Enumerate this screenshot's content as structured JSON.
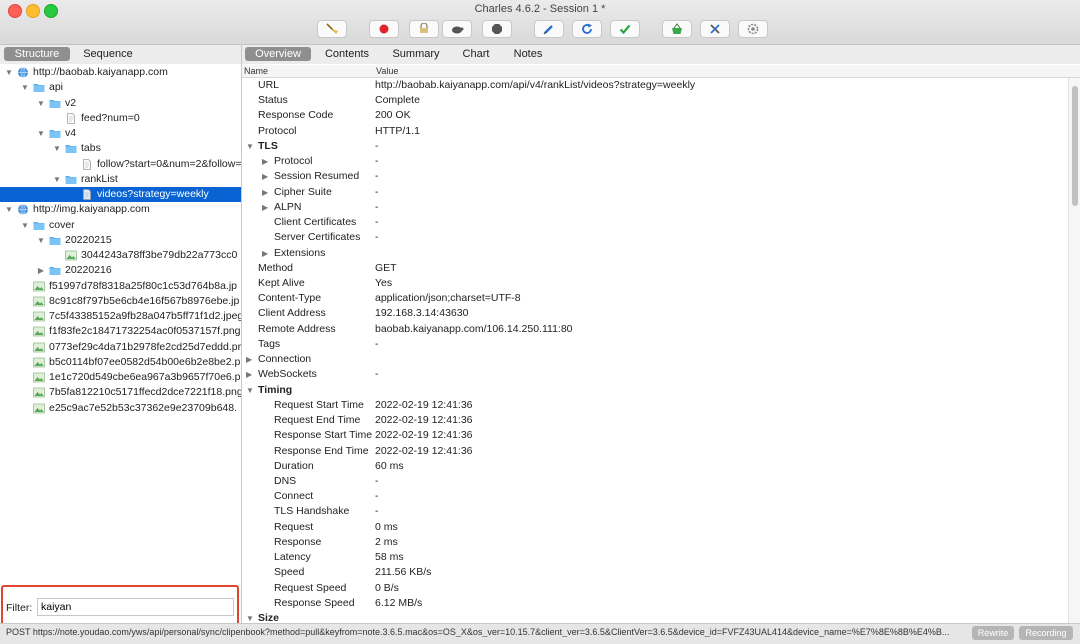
{
  "window": {
    "title": "Charles 4.6.2 - Session 1 *"
  },
  "toolbar": {
    "buttons": [
      {
        "icon": "broom-icon"
      },
      {
        "icon": "record-icon"
      },
      {
        "icon": "throttle-icon"
      },
      {
        "icon": "turtle-icon"
      },
      {
        "icon": "stop-icon"
      },
      {
        "icon": "pen-icon"
      },
      {
        "icon": "refresh-icon"
      },
      {
        "icon": "check-icon"
      },
      {
        "icon": "basket-icon"
      },
      {
        "icon": "tools-icon"
      },
      {
        "icon": "settings-icon"
      }
    ]
  },
  "left": {
    "tabs": [
      "Structure",
      "Sequence"
    ],
    "active_tab": "Structure",
    "tree": [
      {
        "label": "http://baobab.kaiyanapp.com",
        "type": "host",
        "expanded": true
      },
      {
        "label": "api",
        "type": "folder",
        "expanded": true
      },
      {
        "label": "v2",
        "type": "folder",
        "expanded": true
      },
      {
        "label": "feed?num=0",
        "type": "file"
      },
      {
        "label": "v4",
        "type": "folder",
        "expanded": true
      },
      {
        "label": "tabs",
        "type": "folder",
        "expanded": true
      },
      {
        "label": "follow?start=0&num=2&follow=",
        "type": "file"
      },
      {
        "label": "rankList",
        "type": "folder",
        "expanded": true
      },
      {
        "label": "videos?strategy=weekly",
        "type": "file",
        "selected": true
      },
      {
        "label": "http://img.kaiyanapp.com",
        "type": "host",
        "expanded": true
      },
      {
        "label": "cover",
        "type": "folder",
        "expanded": true
      },
      {
        "label": "20220215",
        "type": "folder",
        "expanded": true
      },
      {
        "label": "3044243a78ff3be79db22a773cc0",
        "type": "image"
      },
      {
        "label": "20220216",
        "type": "folder",
        "expanded": false
      },
      {
        "label": "f51997d78f8318a25f80c1c53d764b8a.jp",
        "type": "image"
      },
      {
        "label": "8c91c8f797b5e6cb4e16f567b8976ebe.jp",
        "type": "image"
      },
      {
        "label": "7c5f43385152a9fb28a047b5ff71f1d2.jpeg",
        "type": "image"
      },
      {
        "label": "f1f83fe2c18471732254ac0f0537157f.png",
        "type": "image"
      },
      {
        "label": "0773ef29c4da71b2978fe2cd25d7eddd.pr",
        "type": "image"
      },
      {
        "label": "b5c0114bf07ee0582d54b00e6b2e8be2.p",
        "type": "image"
      },
      {
        "label": "1e1c720d549cbe6ea967a3b9657f70e6.p",
        "type": "image"
      },
      {
        "label": "7b5fa812210c5171ffecd2dce7221f18.png?",
        "type": "image"
      },
      {
        "label": "e25c9ac7e52b53c37362e9e23709b648.",
        "type": "image"
      }
    ],
    "filter": {
      "label": "Filter:",
      "value": "kaiyan"
    }
  },
  "right": {
    "tabs": [
      "Overview",
      "Contents",
      "Summary",
      "Chart",
      "Notes"
    ],
    "active_tab": "Overview",
    "columns": [
      "Name",
      "Value"
    ],
    "rows": [
      {
        "name": "URL",
        "value": "http://baobab.kaiyanapp.com/api/v4/rankList/videos?strategy=weekly",
        "level": 1
      },
      {
        "name": "Status",
        "value": "Complete",
        "level": 1
      },
      {
        "name": "Response Code",
        "value": "200 OK",
        "level": 1
      },
      {
        "name": "Protocol",
        "value": "HTTP/1.1",
        "level": 1
      },
      {
        "name": "TLS",
        "value": "-",
        "level": 0,
        "toggle": "open",
        "bold": true
      },
      {
        "name": "Protocol",
        "value": "-",
        "level": 2,
        "toggle": "closed"
      },
      {
        "name": "Session Resumed",
        "value": "-",
        "level": 2,
        "toggle": "closed"
      },
      {
        "name": "Cipher Suite",
        "value": "-",
        "level": 2,
        "toggle": "closed"
      },
      {
        "name": "ALPN",
        "value": "-",
        "level": 2,
        "toggle": "closed"
      },
      {
        "name": "Client Certificates",
        "value": "-",
        "level": 2
      },
      {
        "name": "Server Certificates",
        "value": "-",
        "level": 2
      },
      {
        "name": "Extensions",
        "value": "",
        "level": 2,
        "toggle": "closed"
      },
      {
        "name": "Method",
        "value": "GET",
        "level": 1
      },
      {
        "name": "Kept Alive",
        "value": "Yes",
        "level": 1
      },
      {
        "name": "Content-Type",
        "value": "application/json;charset=UTF-8",
        "level": 1
      },
      {
        "name": "Client Address",
        "value": "192.168.3.14:43630",
        "level": 1
      },
      {
        "name": "Remote Address",
        "value": "baobab.kaiyanapp.com/106.14.250.111:80",
        "level": 1
      },
      {
        "name": "Tags",
        "value": "-",
        "level": 1
      },
      {
        "name": "Connection",
        "value": "",
        "level": 0,
        "toggle": "closed"
      },
      {
        "name": "WebSockets",
        "value": "-",
        "level": 0,
        "toggle": "closed"
      },
      {
        "name": "Timing",
        "value": "",
        "level": 0,
        "toggle": "open",
        "bold": true
      },
      {
        "name": "Request Start Time",
        "value": "2022-02-19 12:41:36",
        "level": 2
      },
      {
        "name": "Request End Time",
        "value": "2022-02-19 12:41:36",
        "level": 2
      },
      {
        "name": "Response Start Time",
        "value": "2022-02-19 12:41:36",
        "level": 2
      },
      {
        "name": "Response End Time",
        "value": "2022-02-19 12:41:36",
        "level": 2
      },
      {
        "name": "Duration",
        "value": "60 ms",
        "level": 2
      },
      {
        "name": "DNS",
        "value": "-",
        "level": 2
      },
      {
        "name": "Connect",
        "value": "-",
        "level": 2
      },
      {
        "name": "TLS Handshake",
        "value": "-",
        "level": 2
      },
      {
        "name": "Request",
        "value": "0 ms",
        "level": 2
      },
      {
        "name": "Response",
        "value": "2 ms",
        "level": 2
      },
      {
        "name": "Latency",
        "value": "58 ms",
        "level": 2
      },
      {
        "name": "Speed",
        "value": "211.56 KB/s",
        "level": 2
      },
      {
        "name": "Request Speed",
        "value": "0 B/s",
        "level": 2
      },
      {
        "name": "Response Speed",
        "value": "6.12 MB/s",
        "level": 2
      },
      {
        "name": "Size",
        "value": "",
        "level": 0,
        "toggle": "open",
        "bold": true
      }
    ]
  },
  "status": {
    "text": "POST https://note.youdao.com/yws/api/personal/sync/clipenbook?method=pull&keyfrom=note.3.6.5.mac&os=OS_X&os_ver=10.15.7&client_ver=3.6.5&ClientVer=3.6.5&device_id=FVFZ43UAL414&device_name=%E7%8E%8B%E4%B...",
    "rewrite": "Rewrite",
    "recording": "Recording"
  },
  "colors": {
    "accent": "#0a63d3",
    "highlight_border": "#e0452f"
  }
}
